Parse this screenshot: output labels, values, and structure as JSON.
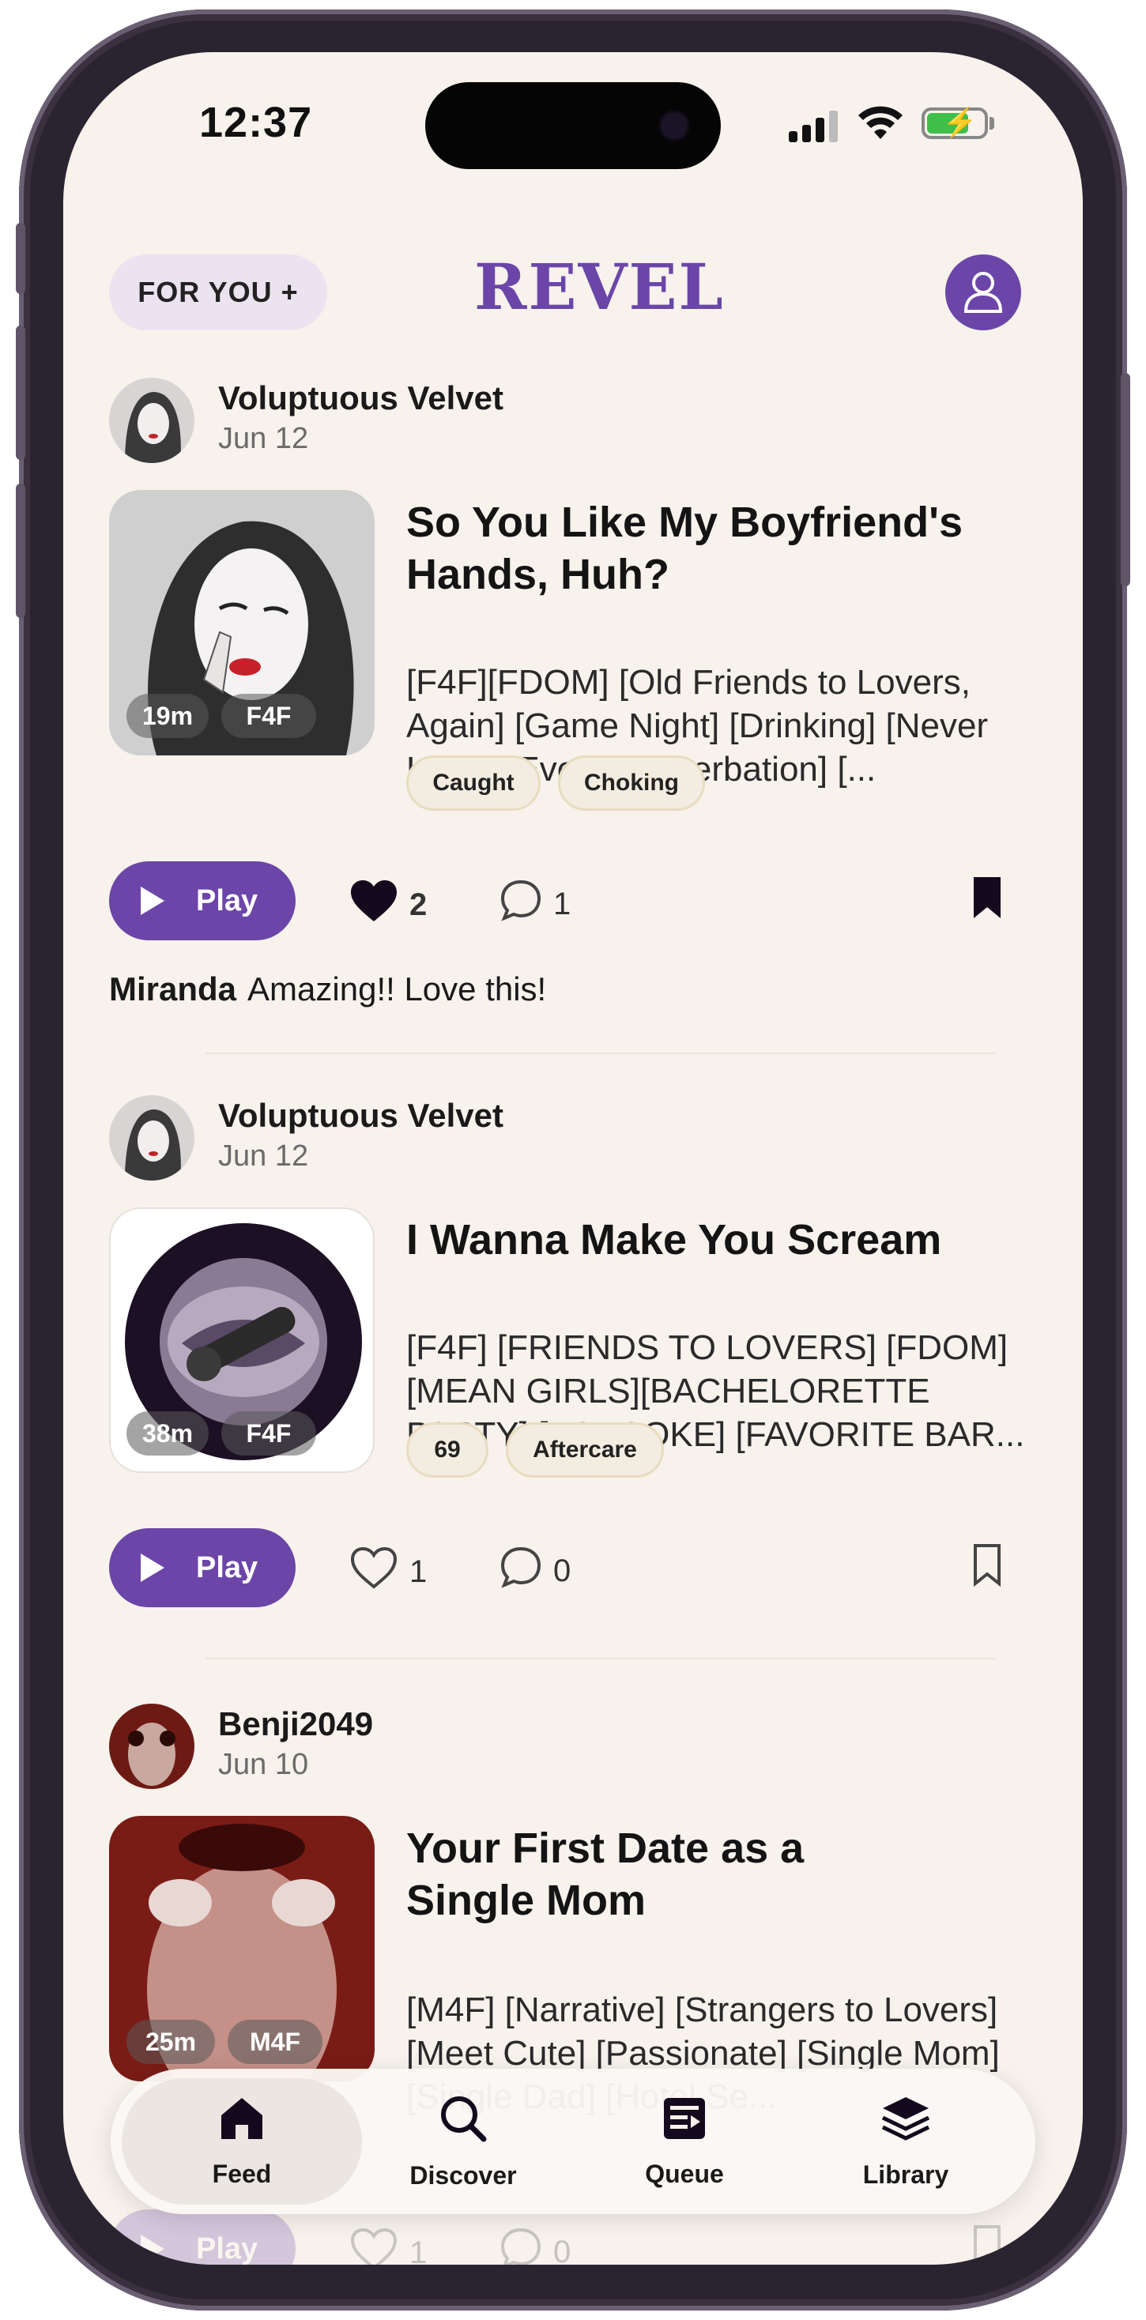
{
  "status_bar": {
    "time": "12:37"
  },
  "header": {
    "for_you_label": "FOR YOU +",
    "logo": "REVEL",
    "profile_icon": "user-icon"
  },
  "colors": {
    "accent": "#6b46a8",
    "background": "#f7f2ec",
    "tag_bg": "#f3ece0",
    "tag_border": "#e8dcc0"
  },
  "posts": [
    {
      "author": "Voluptuous Velvet",
      "date": "Jun 12",
      "duration": "19m",
      "category": "F4F",
      "title": "So You Like My Boyfriend's Hands, Huh?",
      "description": "[F4F][FDOM] [Old Friends to Lovers, Again] [Game Night] [Drinking] [Never Have I Ever] [Masterbation] [...",
      "tags": [
        "Caught",
        "Choking"
      ],
      "play_label": "Play",
      "likes": "2",
      "liked": true,
      "comments": "1",
      "bookmarked": true,
      "top_comment": {
        "user": "Miranda",
        "text": "Amazing!! Love this!"
      }
    },
    {
      "author": "Voluptuous Velvet",
      "date": "Jun 12",
      "duration": "38m",
      "category": "F4F",
      "title": "I Wanna Make You Scream",
      "description": "[F4F] [FRIENDS TO LOVERS] [FDOM] [MEAN GIRLS][BACHELORETTE PARTY] [KARAOKE] [FAVORITE BAR...",
      "tags": [
        "69",
        "Aftercare"
      ],
      "play_label": "Play",
      "likes": "1",
      "liked": false,
      "comments": "0",
      "bookmarked": false
    },
    {
      "author": "Benji2049",
      "date": "Jun 10",
      "duration": "25m",
      "category": "M4F",
      "title": "Your First Date as a Single Mom",
      "description": "[M4F] [Narrative] [Strangers to Lovers] [Meet Cute] [Passionate] [Single Mom] [Single Dad] [Hotel Se...",
      "play_label": "Play",
      "likes": "1",
      "comments": "0"
    }
  ],
  "tabbar": {
    "items": [
      {
        "label": "Feed",
        "icon": "home-icon",
        "active": true
      },
      {
        "label": "Discover",
        "icon": "search-icon",
        "active": false
      },
      {
        "label": "Queue",
        "icon": "queue-icon",
        "active": false
      },
      {
        "label": "Library",
        "icon": "layers-icon",
        "active": false
      }
    ]
  }
}
